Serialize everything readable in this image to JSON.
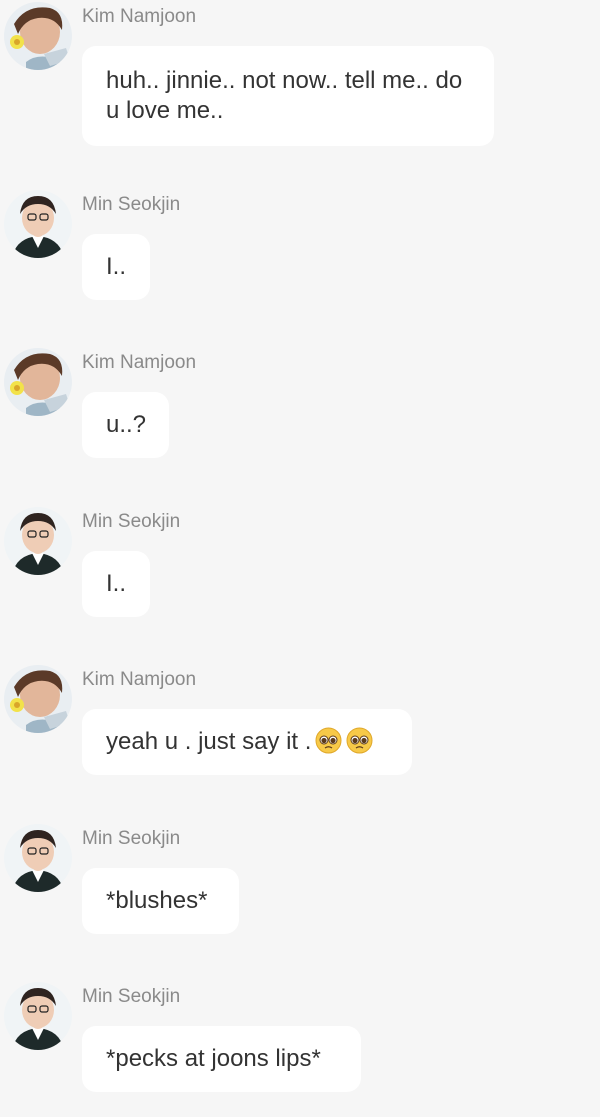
{
  "messages": [
    {
      "sender": "Kim Namjoon",
      "text": "huh.. jinnie.. not now.. tell me.. do u love me..",
      "avatar": "namjoon-avatar"
    },
    {
      "sender": "Min Seokjin",
      "text": "I..",
      "avatar": "seokjin-avatar"
    },
    {
      "sender": "Kim Namjoon",
      "text": "u..?",
      "avatar": "namjoon-avatar"
    },
    {
      "sender": "Min Seokjin",
      "text": "I..",
      "avatar": "seokjin-avatar"
    },
    {
      "sender": "Kim Namjoon",
      "text": "yeah u . just say it .",
      "emoji": [
        "pleading-face",
        "pleading-face"
      ],
      "avatar": "namjoon-avatar"
    },
    {
      "sender": "Min Seokjin",
      "text": "*blushes*",
      "avatar": "seokjin-avatar"
    },
    {
      "sender": "Min Seokjin",
      "text": "*pecks at joons lips*",
      "avatar": "seokjin-avatar"
    }
  ],
  "colors": {
    "background": "#f6f6f6",
    "bubble": "#ffffff",
    "sender_name": "#8a8a8a",
    "message_text": "#333333"
  }
}
